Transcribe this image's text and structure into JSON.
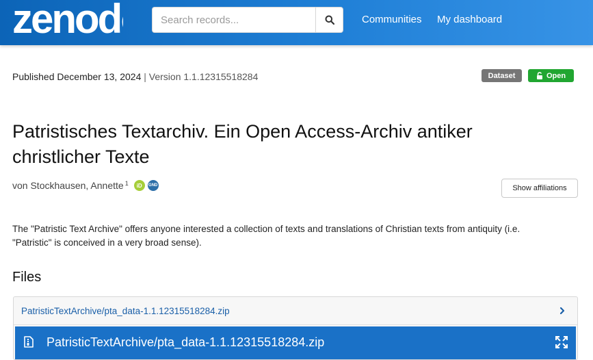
{
  "header": {
    "logo_text": "zenodo",
    "search": {
      "placeholder": "Search records...",
      "value": ""
    },
    "nav": {
      "communities": "Communities",
      "dashboard": "My dashboard"
    }
  },
  "record": {
    "published_label": "Published",
    "published_date": "December 13, 2024",
    "separator": "|",
    "version": "Version 1.1.12315518284",
    "badges": {
      "type": "Dataset",
      "access": "Open"
    },
    "title": "Patristisches Textarchiv. Ein Open Access-Archiv antiker christlicher Texte",
    "creator": {
      "name": "von Stockhausen, Annette",
      "affiliation_ref": "1",
      "orcid_icon": "iD",
      "gnd_icon": "GND"
    },
    "show_affiliations": "Show affiliations",
    "description": "The \"Patristic Text Archive\" offers anyone interested a collection of texts and translations of Christian texts from antiquity (i.e. \"Patristic\" is conceived in a very broad sense)."
  },
  "files": {
    "heading": "Files",
    "accordion_label": "PatristicTextArchive/pta_data-1.1.12315518284.zip",
    "preview_name": "PatristicTextArchive/pta_data-1.1.12315518284.zip"
  },
  "colors": {
    "navbar": "#0c64b7",
    "open_badge": "#21a631",
    "dataset_badge": "#767676",
    "preview_bar": "#1a71c7",
    "link": "#1a5fa8"
  },
  "icons": [
    "search-icon",
    "lock-open-icon",
    "orcid-icon",
    "gnd-icon",
    "chevron-right-icon",
    "file-zip-icon",
    "expand-icon"
  ]
}
